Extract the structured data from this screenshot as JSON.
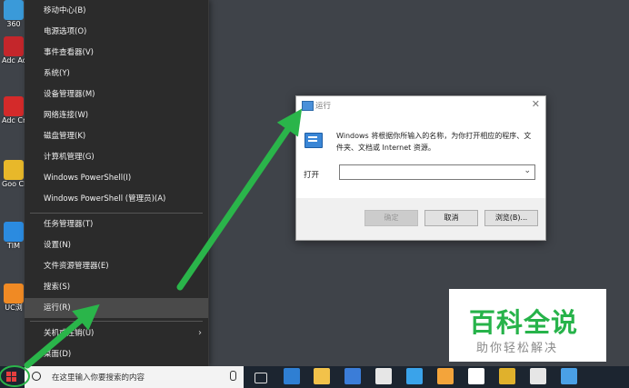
{
  "desktop": {
    "icons": [
      {
        "label": "360",
        "color": "#3a9ad9"
      },
      {
        "label": "Adc Acrob",
        "color": "#c4262b"
      },
      {
        "label": "Adc Crea",
        "color": "#d42a2a"
      },
      {
        "label": "Goo Chro",
        "color": "#e8b82a"
      },
      {
        "label": "TIM",
        "color": "#2b8be0"
      },
      {
        "label": "UC浏",
        "color": "#f08a24"
      }
    ]
  },
  "winx_menu": {
    "items": [
      "移动中心(B)",
      "电源选项(O)",
      "事件查看器(V)",
      "系统(Y)",
      "设备管理器(M)",
      "网络连接(W)",
      "磁盘管理(K)",
      "计算机管理(G)",
      "Windows PowerShell(I)",
      "Windows PowerShell (管理员)(A)",
      "任务管理器(T)",
      "设置(N)",
      "文件资源管理器(E)",
      "搜索(S)",
      "运行(R)",
      "关机或注销(U)",
      "桌面(D)"
    ],
    "highlighted": "运行(R)"
  },
  "run_dialog": {
    "title": "运行",
    "description": "Windows 将根据你所输入的名称，为你打开相应的程序、文件夹、文档或 Internet 资源。",
    "open_label": "打开",
    "input_value": "",
    "ok": "确定",
    "cancel": "取消",
    "browse": "浏览(B)..."
  },
  "taskbar": {
    "search_placeholder": "在这里输入你要搜索的内容",
    "apps": [
      {
        "name": "task-view-icon",
        "color": "#1c2530"
      },
      {
        "name": "edge-icon",
        "color": "#2f7fd3"
      },
      {
        "name": "file-explorer-icon",
        "color": "#f2c24a"
      },
      {
        "name": "store-icon",
        "color": "#3b7dd8"
      },
      {
        "name": "mail-icon",
        "color": "#e6e6e6"
      },
      {
        "name": "feishu-icon",
        "color": "#3aa3ea"
      },
      {
        "name": "game-icon",
        "color": "#f3a43b"
      },
      {
        "name": "bilibili-icon",
        "color": "#ffffff"
      },
      {
        "name": "chrome-icon",
        "color": "#e0b12c"
      },
      {
        "name": "settings-icon",
        "color": "#e6e6e6"
      },
      {
        "name": "remote-desktop-icon",
        "color": "#4aa0e6"
      }
    ]
  },
  "watermark": {
    "title": "百科全说",
    "subtitle": "助你轻松解决"
  },
  "colors": {
    "accent_green": "#2ab54a",
    "menu_bg": "#2b2b2b",
    "desktop_bg": "#3f4349"
  }
}
